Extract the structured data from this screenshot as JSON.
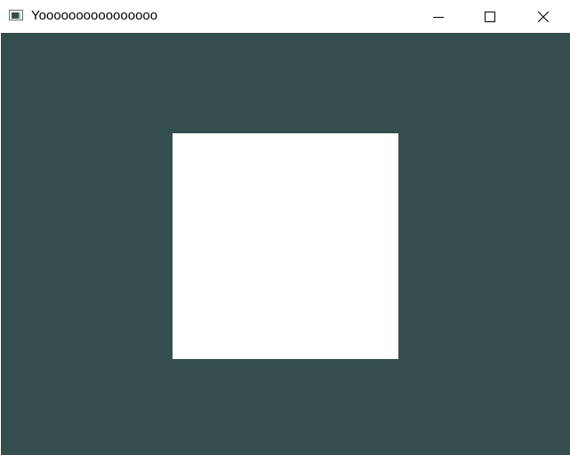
{
  "window": {
    "title": "Yoooooooooooooooo",
    "controls": {
      "minimize_icon": "minimize-icon",
      "maximize_icon": "maximize-icon",
      "close_icon": "close-icon"
    }
  },
  "client": {
    "background_color": "#344e4e",
    "shape_color": "#ffffff"
  }
}
